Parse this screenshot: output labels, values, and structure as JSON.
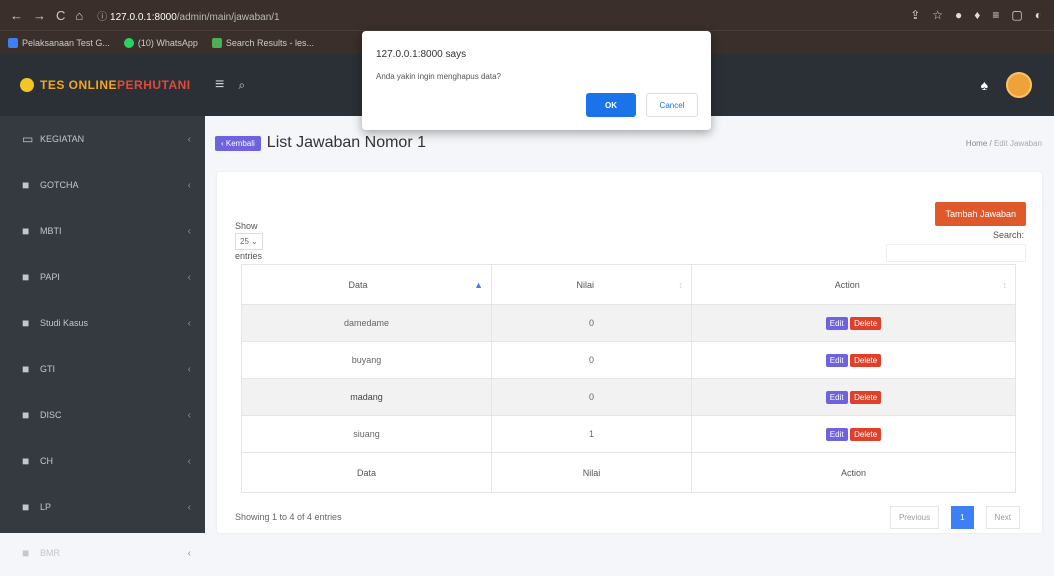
{
  "browser": {
    "url_host": "127.0.0.1:8000",
    "url_path": "/admin/main/jawaban/1",
    "nav_back": "←",
    "nav_forward": "→",
    "nav_reload": "C",
    "nav_home": "⌂",
    "info_icon": "ⓘ"
  },
  "bookmarks": [
    {
      "label": "Pelaksanaan Test G...",
      "color": "#3d7ff5"
    },
    {
      "label": "(10) WhatsApp",
      "color": "#25d366"
    },
    {
      "label": "Search Results - les...",
      "color": "#4caf50"
    }
  ],
  "topnav": {
    "logo_a": "TES ONLINE",
    "logo_b": "PERHUTANI",
    "menu_icon": "≡",
    "search_icon": "⌕",
    "bell_icon": "♠"
  },
  "sidebar": {
    "items": [
      {
        "label": "KEGIATAN"
      },
      {
        "label": "GOTCHA"
      },
      {
        "label": "MBTI"
      },
      {
        "label": "PAPI"
      },
      {
        "label": "Studi Kasus"
      },
      {
        "label": "GTI"
      },
      {
        "label": "DISC"
      },
      {
        "label": "CH"
      },
      {
        "label": "LP"
      },
      {
        "label": "BMR"
      }
    ]
  },
  "page": {
    "back_label": "‹ Kembali",
    "title": "List Jawaban Nomor 1",
    "breadcrumb_home": "Home",
    "breadcrumb_sep": "/",
    "breadcrumb_active": "Edit Jawaban",
    "add_button": "Tambah Jawaban",
    "show_label": "Show",
    "entries_value": "25",
    "entries_label": "entries",
    "search_label": "Search:"
  },
  "table": {
    "columns": [
      "Data",
      "Nilai",
      "Action"
    ],
    "rows": [
      {
        "data": "damedame",
        "nilai": "0"
      },
      {
        "data": "buyang",
        "nilai": "0"
      },
      {
        "data": "madang",
        "nilai": "0"
      },
      {
        "data": "siuang",
        "nilai": "1"
      }
    ],
    "edit_label": "Edit",
    "delete_label": "Delete",
    "info": "Showing 1 to 4 of 4 entries",
    "prev": "Previous",
    "page": "1",
    "next": "Next"
  },
  "dialog": {
    "title": "127.0.0.1:8000 says",
    "message": "Anda yakin ingin menghapus data?",
    "ok": "OK",
    "cancel": "Cancel"
  }
}
